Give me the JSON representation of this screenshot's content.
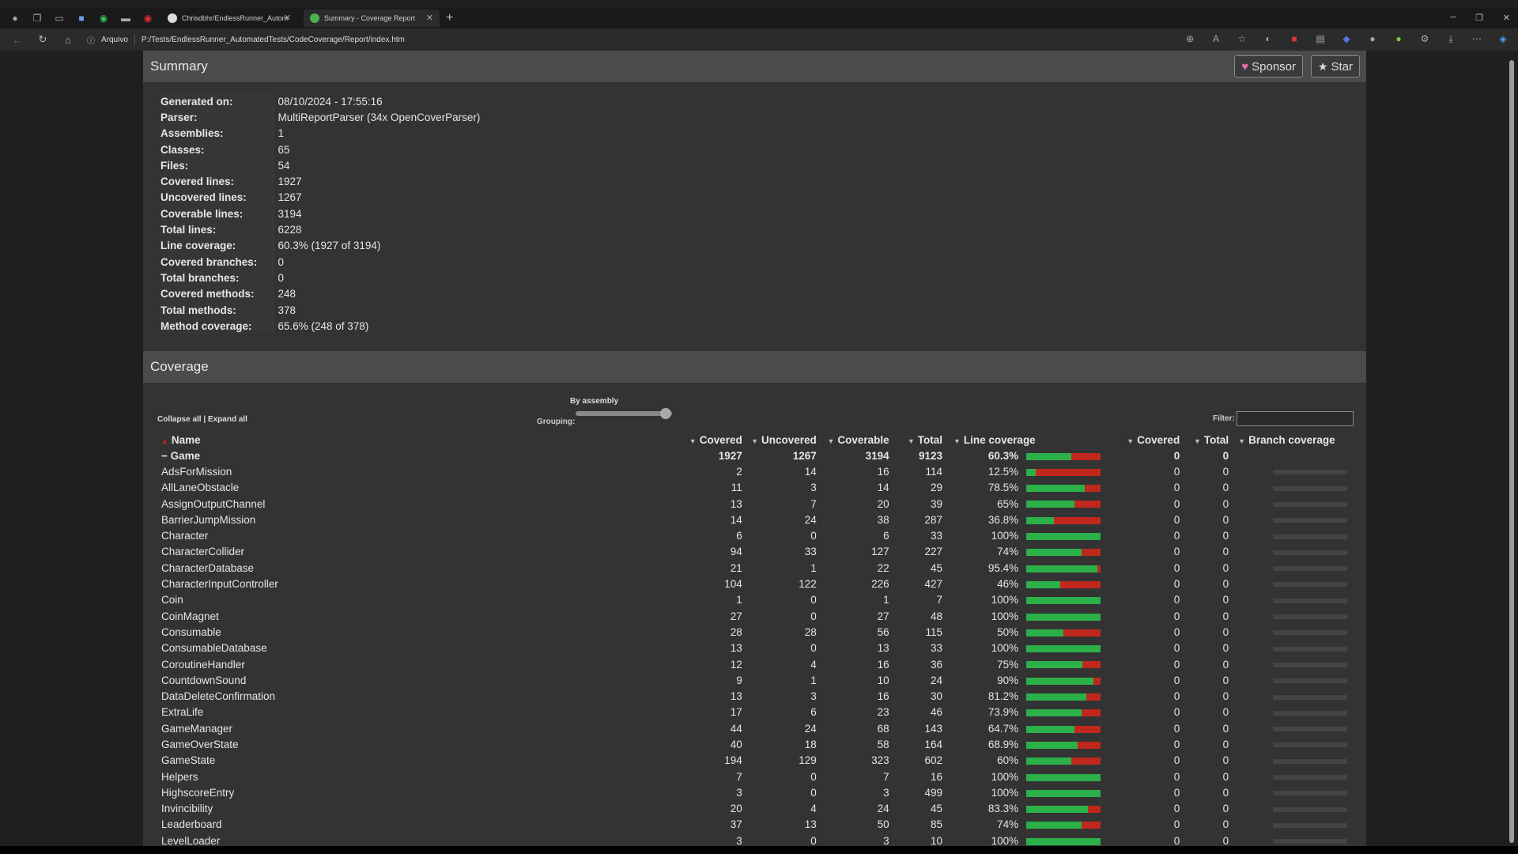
{
  "browser": {
    "tabs": [
      {
        "label": "Chrisdbhr/EndlessRunner_Autom",
        "active": false
      },
      {
        "label": "Summary - Coverage Report",
        "active": true
      }
    ],
    "address": {
      "info_label": "Arquivo",
      "url": "P:/Tests/EndlessRunner_AutomatedTests/CodeCoverage/Report/index.htm"
    }
  },
  "summary": {
    "title": "Summary",
    "sponsor_label": "Sponsor",
    "star_label": "Star",
    "rows": [
      {
        "label": "Generated on:",
        "value": "08/10/2024 - 17:55:16"
      },
      {
        "label": "Parser:",
        "value": "MultiReportParser (34x OpenCoverParser)"
      },
      {
        "label": "Assemblies:",
        "value": "1"
      },
      {
        "label": "Classes:",
        "value": "65"
      },
      {
        "label": "Files:",
        "value": "54"
      },
      {
        "label": "Covered lines:",
        "value": "1927"
      },
      {
        "label": "Uncovered lines:",
        "value": "1267"
      },
      {
        "label": "Coverable lines:",
        "value": "3194"
      },
      {
        "label": "Total lines:",
        "value": "6228"
      },
      {
        "label": "Line coverage:",
        "value": "60.3% (1927 of 3194)"
      },
      {
        "label": "Covered branches:",
        "value": "0"
      },
      {
        "label": "Total branches:",
        "value": "0"
      },
      {
        "label": "Covered methods:",
        "value": "248"
      },
      {
        "label": "Total methods:",
        "value": "378"
      },
      {
        "label": "Method coverage:",
        "value": "65.6% (248 of 378)"
      }
    ]
  },
  "coverage": {
    "title": "Coverage",
    "collapse_label": "Collapse all",
    "expand_label": "Expand all",
    "grouping_title": "By assembly",
    "grouping_label": "Grouping:",
    "filter_label": "Filter:",
    "columns": [
      "Name",
      "Covered",
      "Uncovered",
      "Coverable",
      "Total",
      "Line coverage",
      "Covered",
      "Total",
      "Branch coverage"
    ],
    "group": {
      "name": "Game",
      "covered": "1927",
      "uncovered": "1267",
      "coverable": "3194",
      "total": "9123",
      "pct": "60.3%",
      "fraction": 0.603,
      "bcovered": "0",
      "btotal": "0"
    },
    "rows": [
      {
        "name": "AdsForMission",
        "covered": "2",
        "uncovered": "14",
        "coverable": "16",
        "total": "114",
        "pct": "12.5%",
        "fraction": 0.125,
        "bcovered": "0",
        "btotal": "0"
      },
      {
        "name": "AllLaneObstacle",
        "covered": "11",
        "uncovered": "3",
        "coverable": "14",
        "total": "29",
        "pct": "78.5%",
        "fraction": 0.785,
        "bcovered": "0",
        "btotal": "0"
      },
      {
        "name": "AssignOutputChannel",
        "covered": "13",
        "uncovered": "7",
        "coverable": "20",
        "total": "39",
        "pct": "65%",
        "fraction": 0.65,
        "bcovered": "0",
        "btotal": "0"
      },
      {
        "name": "BarrierJumpMission",
        "covered": "14",
        "uncovered": "24",
        "coverable": "38",
        "total": "287",
        "pct": "36.8%",
        "fraction": 0.368,
        "bcovered": "0",
        "btotal": "0"
      },
      {
        "name": "Character",
        "covered": "6",
        "uncovered": "0",
        "coverable": "6",
        "total": "33",
        "pct": "100%",
        "fraction": 1.0,
        "bcovered": "0",
        "btotal": "0"
      },
      {
        "name": "CharacterCollider",
        "covered": "94",
        "uncovered": "33",
        "coverable": "127",
        "total": "227",
        "pct": "74%",
        "fraction": 0.74,
        "bcovered": "0",
        "btotal": "0"
      },
      {
        "name": "CharacterDatabase",
        "covered": "21",
        "uncovered": "1",
        "coverable": "22",
        "total": "45",
        "pct": "95.4%",
        "fraction": 0.954,
        "bcovered": "0",
        "btotal": "0"
      },
      {
        "name": "CharacterInputController",
        "covered": "104",
        "uncovered": "122",
        "coverable": "226",
        "total": "427",
        "pct": "46%",
        "fraction": 0.46,
        "bcovered": "0",
        "btotal": "0"
      },
      {
        "name": "Coin",
        "covered": "1",
        "uncovered": "0",
        "coverable": "1",
        "total": "7",
        "pct": "100%",
        "fraction": 1.0,
        "bcovered": "0",
        "btotal": "0"
      },
      {
        "name": "CoinMagnet",
        "covered": "27",
        "uncovered": "0",
        "coverable": "27",
        "total": "48",
        "pct": "100%",
        "fraction": 1.0,
        "bcovered": "0",
        "btotal": "0"
      },
      {
        "name": "Consumable",
        "covered": "28",
        "uncovered": "28",
        "coverable": "56",
        "total": "115",
        "pct": "50%",
        "fraction": 0.5,
        "bcovered": "0",
        "btotal": "0"
      },
      {
        "name": "ConsumableDatabase",
        "covered": "13",
        "uncovered": "0",
        "coverable": "13",
        "total": "33",
        "pct": "100%",
        "fraction": 1.0,
        "bcovered": "0",
        "btotal": "0"
      },
      {
        "name": "CoroutineHandler",
        "covered": "12",
        "uncovered": "4",
        "coverable": "16",
        "total": "36",
        "pct": "75%",
        "fraction": 0.75,
        "bcovered": "0",
        "btotal": "0"
      },
      {
        "name": "CountdownSound",
        "covered": "9",
        "uncovered": "1",
        "coverable": "10",
        "total": "24",
        "pct": "90%",
        "fraction": 0.9,
        "bcovered": "0",
        "btotal": "0"
      },
      {
        "name": "DataDeleteConfirmation",
        "covered": "13",
        "uncovered": "3",
        "coverable": "16",
        "total": "30",
        "pct": "81.2%",
        "fraction": 0.812,
        "bcovered": "0",
        "btotal": "0"
      },
      {
        "name": "ExtraLife",
        "covered": "17",
        "uncovered": "6",
        "coverable": "23",
        "total": "46",
        "pct": "73.9%",
        "fraction": 0.739,
        "bcovered": "0",
        "btotal": "0"
      },
      {
        "name": "GameManager",
        "covered": "44",
        "uncovered": "24",
        "coverable": "68",
        "total": "143",
        "pct": "64.7%",
        "fraction": 0.647,
        "bcovered": "0",
        "btotal": "0"
      },
      {
        "name": "GameOverState",
        "covered": "40",
        "uncovered": "18",
        "coverable": "58",
        "total": "164",
        "pct": "68.9%",
        "fraction": 0.689,
        "bcovered": "0",
        "btotal": "0"
      },
      {
        "name": "GameState",
        "covered": "194",
        "uncovered": "129",
        "coverable": "323",
        "total": "602",
        "pct": "60%",
        "fraction": 0.6,
        "bcovered": "0",
        "btotal": "0"
      },
      {
        "name": "Helpers",
        "covered": "7",
        "uncovered": "0",
        "coverable": "7",
        "total": "16",
        "pct": "100%",
        "fraction": 1.0,
        "bcovered": "0",
        "btotal": "0"
      },
      {
        "name": "HighscoreEntry",
        "covered": "3",
        "uncovered": "0",
        "coverable": "3",
        "total": "499",
        "pct": "100%",
        "fraction": 1.0,
        "bcovered": "0",
        "btotal": "0"
      },
      {
        "name": "Invincibility",
        "covered": "20",
        "uncovered": "4",
        "coverable": "24",
        "total": "45",
        "pct": "83.3%",
        "fraction": 0.833,
        "bcovered": "0",
        "btotal": "0"
      },
      {
        "name": "Leaderboard",
        "covered": "37",
        "uncovered": "13",
        "coverable": "50",
        "total": "85",
        "pct": "74%",
        "fraction": 0.74,
        "bcovered": "0",
        "btotal": "0"
      },
      {
        "name": "LevelLoader",
        "covered": "3",
        "uncovered": "0",
        "coverable": "3",
        "total": "10",
        "pct": "100%",
        "fraction": 1.0,
        "bcovered": "0",
        "btotal": "0"
      }
    ]
  },
  "colors": {
    "covered": "#2bb04a",
    "uncovered": "#c0271d",
    "header_bg": "#4b4b4b",
    "page_bg": "#333333"
  }
}
